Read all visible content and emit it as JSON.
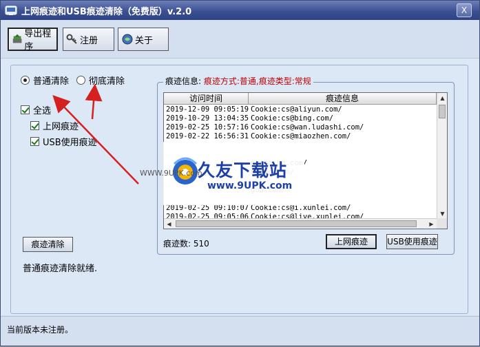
{
  "window": {
    "title": "上网痕迹和USB痕迹清除（免费版）v.2.0",
    "close_label": "X"
  },
  "toolbar": {
    "buttons": [
      {
        "label": "导出程序",
        "icon": "export-icon"
      },
      {
        "label": "注册",
        "icon": "key-icon"
      },
      {
        "label": "关于",
        "icon": "about-icon"
      }
    ]
  },
  "options": {
    "mode_normal": "普通清除",
    "mode_full": "彻底清除",
    "select_all": "全选",
    "internet_trace": "上网痕迹",
    "usb_trace": "USB使用痕迹",
    "clean_button": "痕迹清除",
    "status_message": "普通痕迹清除就绪."
  },
  "trace_panel": {
    "legend_label": "痕迹信息:",
    "legend_detail": "痕迹方式:普通,痕迹类型:常规",
    "columns": [
      "访问时间",
      "痕迹信息"
    ],
    "rows": [
      {
        "time": "2019-12-09 09:05:19",
        "info": "Cookie:cs@aliyun.com/"
      },
      {
        "time": "2019-10-29 13:04:35",
        "info": "Cookie:cs@bing.com/"
      },
      {
        "time": "2019-02-25 10:57:16",
        "info": "Cookie:cs@wan.ludashi.com/"
      },
      {
        "time": "2019-02-22 16:56:31",
        "info": "Cookie:cs@miaozhen.com/"
      },
      {
        "time": "",
        "info": ""
      },
      {
        "time": "",
        "info": ""
      },
      {
        "time": "",
        "info": "ptcha.qq.com/"
      },
      {
        "time": "",
        "info": "n2.qq.com/"
      },
      {
        "time": "",
        "info": ""
      },
      {
        "time": "",
        "info": "gou.com/"
      },
      {
        "time": "",
        "info": ""
      },
      {
        "time": "2019-02-25 09:10:07",
        "info": "Cookie:cs@i.xunlei.com/"
      },
      {
        "time": "2019-02-25 09:05:06",
        "info": "Cookie:cs@live.xunlei.com/"
      }
    ],
    "count_label": "痕迹数: 510",
    "btn_internet": "上网痕迹",
    "btn_usb": "USB使用痕迹"
  },
  "watermark": {
    "small_text": "WWW.9UPK.com",
    "brand": "久友下载站",
    "url": "www.9UPK.com"
  },
  "statusbar": {
    "text": "当前版本未注册。"
  }
}
